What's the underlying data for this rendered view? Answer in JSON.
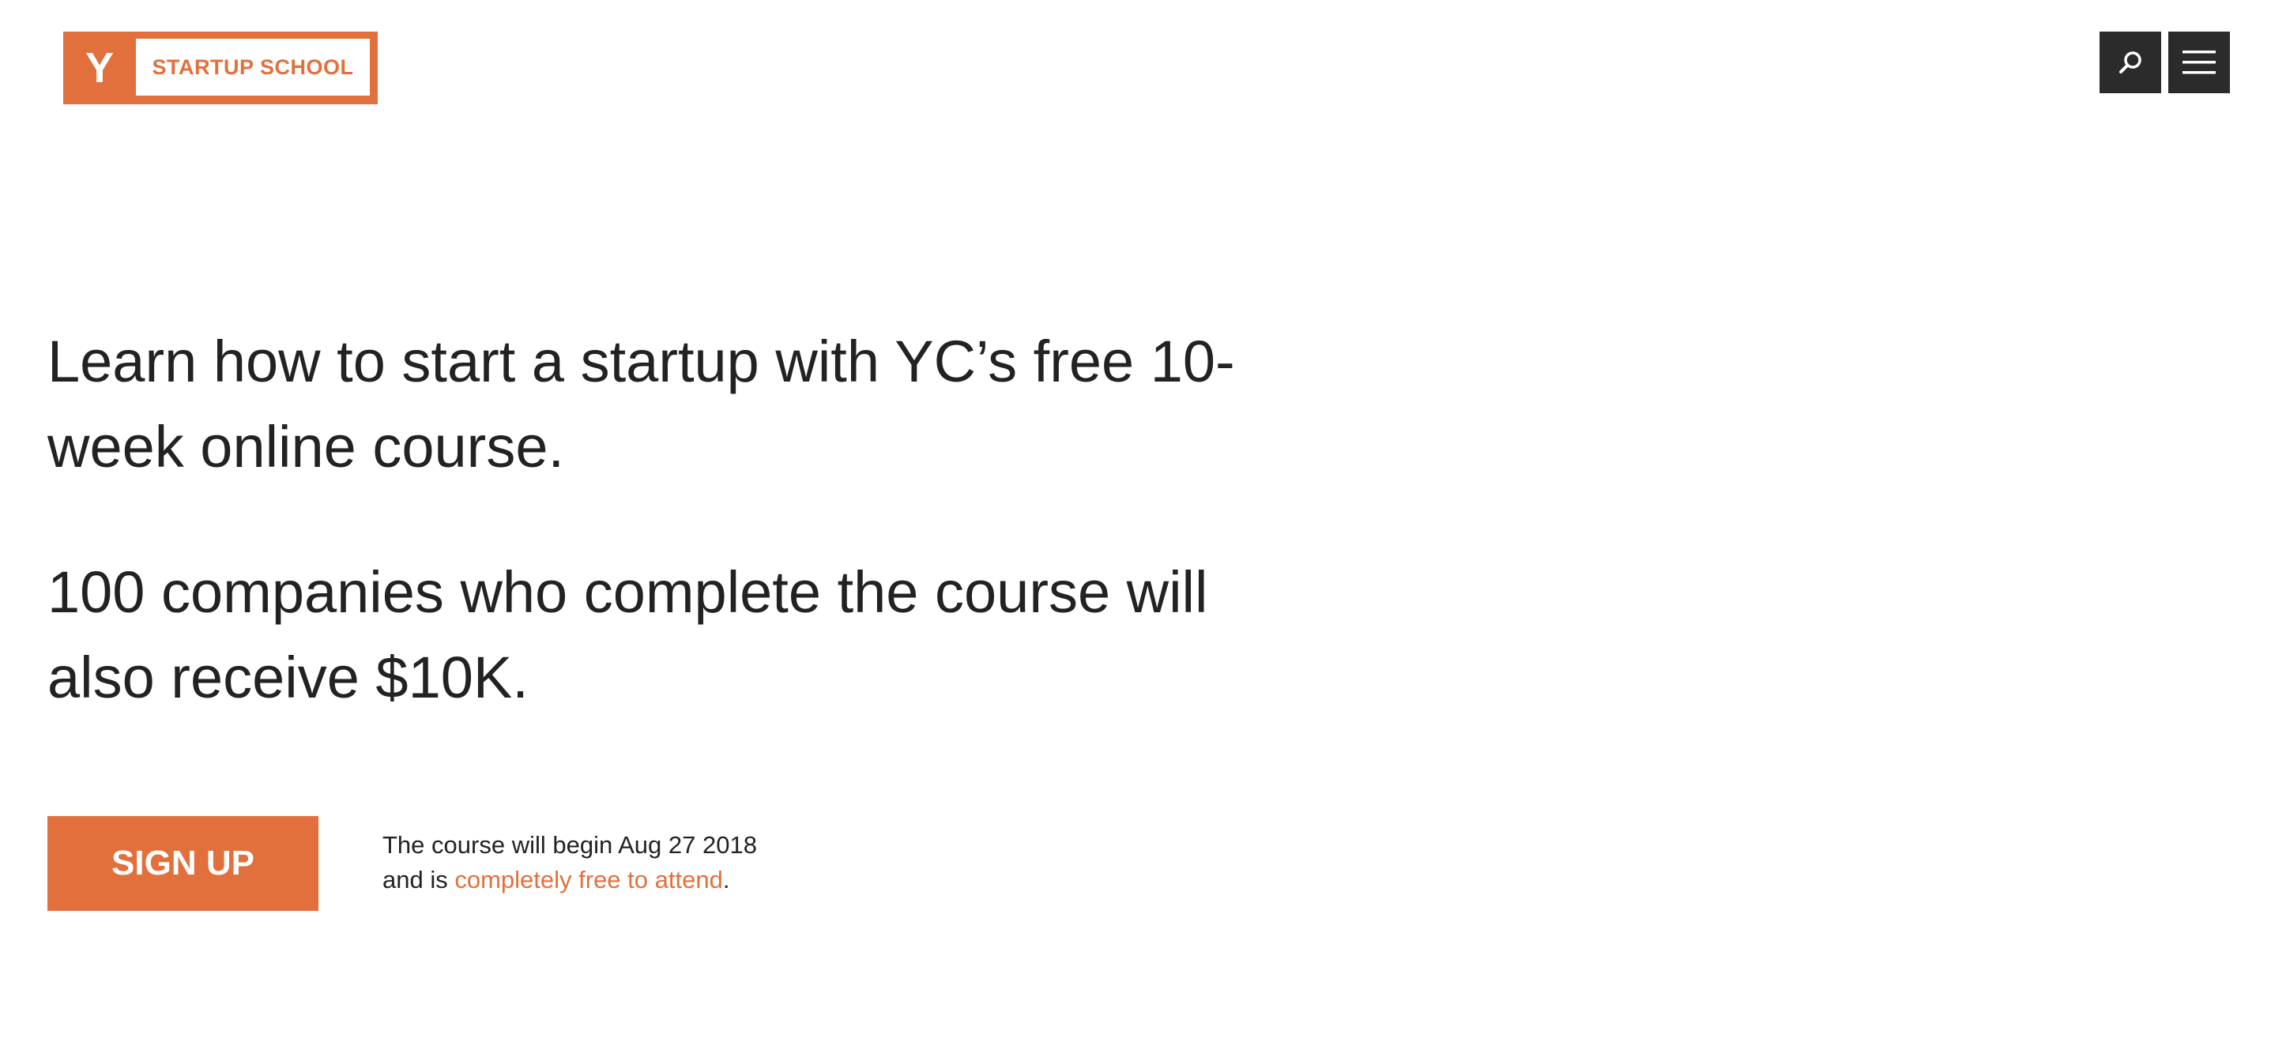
{
  "header": {
    "logo_letter": "Y",
    "logo_text": "STARTUP SCHOOL",
    "icons": {
      "search": "search-icon",
      "menu": "hamburger-menu-icon"
    }
  },
  "hero": {
    "headline_1": "Learn how to start a startup with YC’s free 10-week online course.",
    "headline_2": "100 companies who complete the course will also receive $10K."
  },
  "cta": {
    "signup_label": "SIGN UP",
    "note_line_1": "The course will begin Aug 27 2018",
    "note_line_2_prefix": "and is ",
    "note_link": "completely free to attend",
    "note_line_2_suffix": "."
  },
  "colors": {
    "brand_orange": "#e2703c",
    "dark_button": "#2b2b2b",
    "text": "#222222",
    "background": "#ffffff"
  }
}
